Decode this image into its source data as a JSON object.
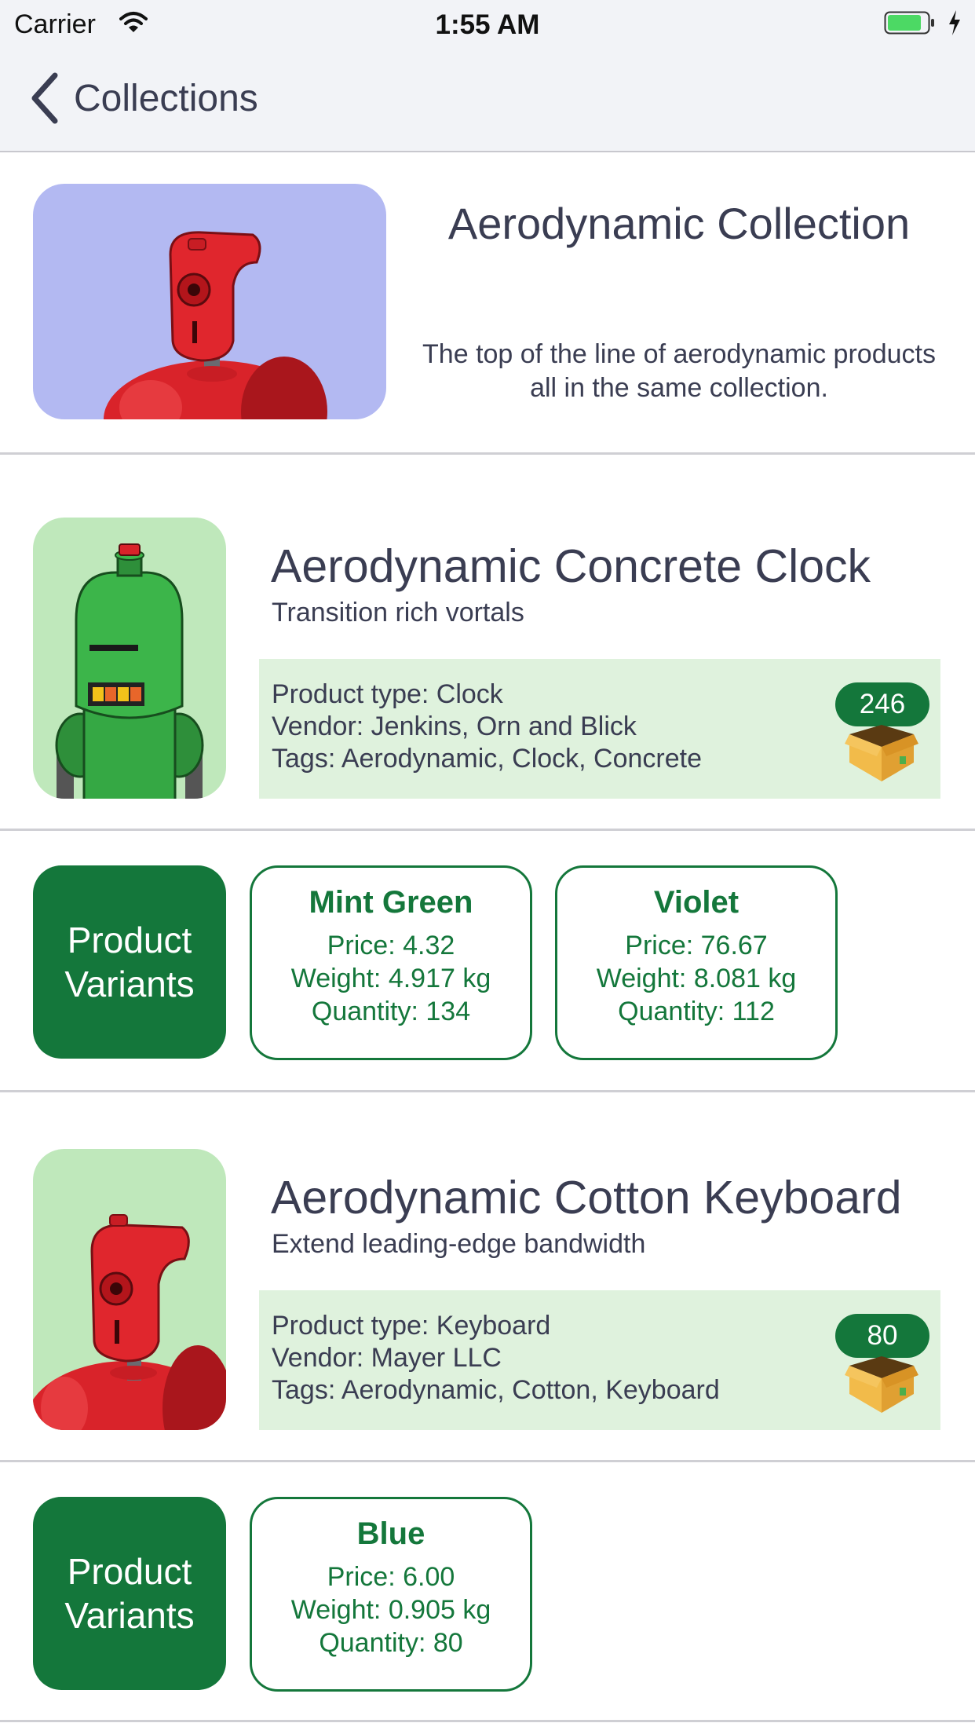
{
  "status_bar": {
    "carrier": "Carrier",
    "time": "1:55 AM",
    "battery_level": 0.85
  },
  "nav": {
    "back_label": "Collections"
  },
  "collection": {
    "title": "Aerodynamic Collection",
    "description": "The top of the line of aerodynamic products all in the same collection."
  },
  "products": [
    {
      "title": "Aerodynamic Concrete Clock",
      "subtitle": "Transition rich vortals",
      "product_type": "Product type: Clock",
      "vendor": "Vendor: Jenkins, Orn and Blick",
      "tags": "Tags: Aerodynamic, Clock, Concrete",
      "quantity": "246",
      "image_icon": "green-robot-icon",
      "variants_label": "Product Variants",
      "variants": [
        {
          "name": "Mint Green",
          "price": "Price: 4.32",
          "weight": "Weight: 4.917 kg",
          "quantity": "Quantity: 134"
        },
        {
          "name": "Violet",
          "price": "Price: 76.67",
          "weight": "Weight: 8.081 kg",
          "quantity": "Quantity: 112"
        }
      ]
    },
    {
      "title": "Aerodynamic Cotton Keyboard",
      "subtitle": "Extend leading-edge bandwidth",
      "product_type": "Product type: Keyboard",
      "vendor": "Vendor: Mayer LLC",
      "tags": "Tags: Aerodynamic, Cotton, Keyboard",
      "quantity": "80",
      "image_icon": "red-robot-icon",
      "variants_label": "Product Variants",
      "variants": [
        {
          "name": "Blue",
          "price": "Price: 6.00",
          "weight": "Weight: 0.905 kg",
          "quantity": "Quantity: 80"
        }
      ]
    }
  ],
  "colors": {
    "accent_green": "#14773b",
    "info_background": "#dff2dd",
    "collection_image_bg": "#b3b9f2",
    "product_image_bg": "#bfe8bb",
    "text": "#3a3d52",
    "bar_background": "#f2f3f7"
  }
}
